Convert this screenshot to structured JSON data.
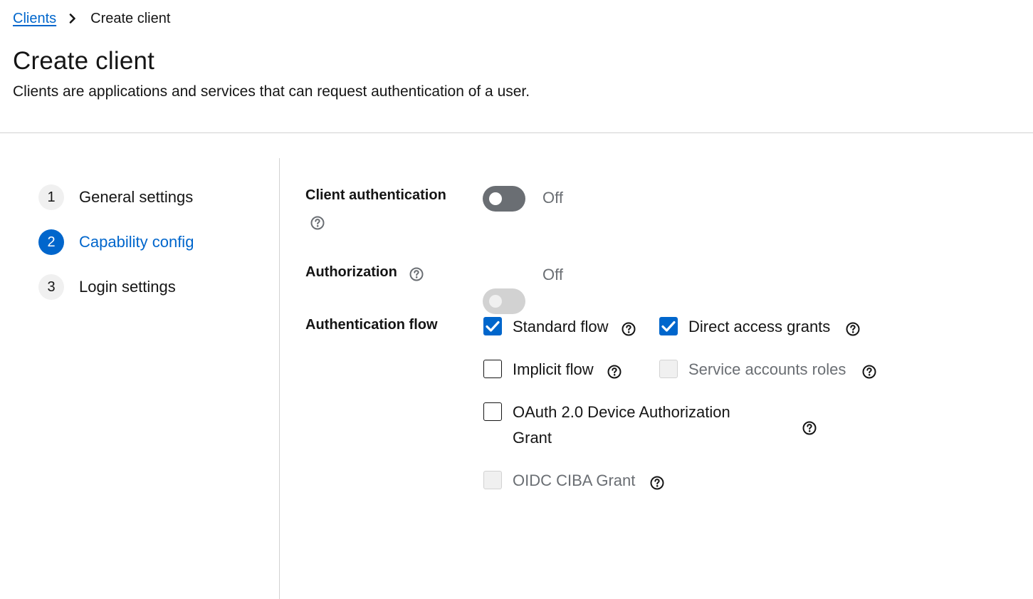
{
  "breadcrumb": {
    "parent": "Clients",
    "current": "Create client"
  },
  "header": {
    "title": "Create client",
    "description": "Clients are applications and services that can request authentication of a user."
  },
  "wizard": {
    "steps": [
      {
        "number": "1",
        "label": "General settings",
        "state": "done"
      },
      {
        "number": "2",
        "label": "Capability config",
        "state": "current"
      },
      {
        "number": "3",
        "label": "Login settings",
        "state": "pending"
      }
    ]
  },
  "form": {
    "client_authentication": {
      "label": "Client authentication",
      "state": "Off",
      "enabled": false
    },
    "authorization": {
      "label": "Authorization",
      "state": "Off",
      "enabled": false,
      "disabled": true
    },
    "authentication_flow": {
      "label": "Authentication flow",
      "options": [
        {
          "label": "Standard flow",
          "checked": true,
          "disabled": false
        },
        {
          "label": "Direct access grants",
          "checked": true,
          "disabled": false
        },
        {
          "label": "Implicit flow",
          "checked": false,
          "disabled": false
        },
        {
          "label": "Service accounts roles",
          "checked": false,
          "disabled": true
        },
        {
          "label_line1": "OAuth 2.0 Device Authorization",
          "label_line2": "Grant",
          "checked": false,
          "disabled": false
        },
        {
          "label": "OIDC CIBA Grant",
          "checked": false,
          "disabled": true
        }
      ]
    }
  },
  "icons": {
    "breadcrumb_separator": "angle-right-icon",
    "help": "question-circle-icon",
    "checkmark": "check-icon"
  },
  "colors": {
    "primary": "#0066cc",
    "switch_off": "#6a6e73",
    "switch_disabled": "#d2d2d2",
    "text": "#151515",
    "muted": "#6a6e73",
    "divider": "#d2d2d2"
  }
}
